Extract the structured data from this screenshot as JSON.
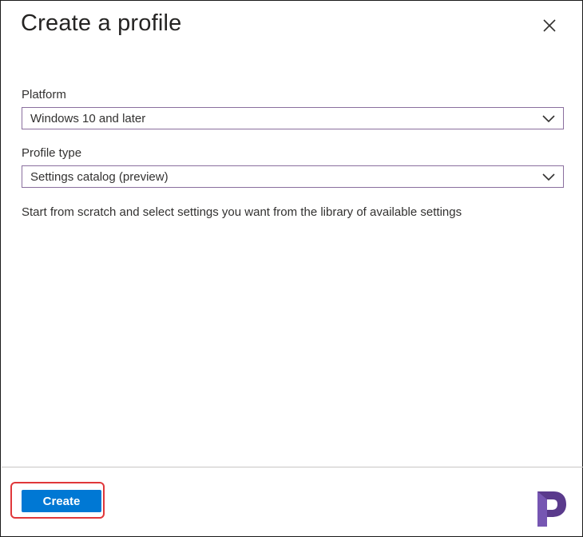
{
  "panel": {
    "title": "Create a profile",
    "close_icon": "close-icon"
  },
  "platform": {
    "label": "Platform",
    "value": "Windows 10 and later"
  },
  "profile_type": {
    "label": "Profile type",
    "value": "Settings catalog (preview)"
  },
  "description": "Start from scratch and select settings you want from the library of available settings",
  "footer": {
    "create_label": "Create"
  },
  "colors": {
    "primary_button": "#0078d4",
    "highlight": "#e0373a",
    "select_border": "#8a6f9e"
  }
}
